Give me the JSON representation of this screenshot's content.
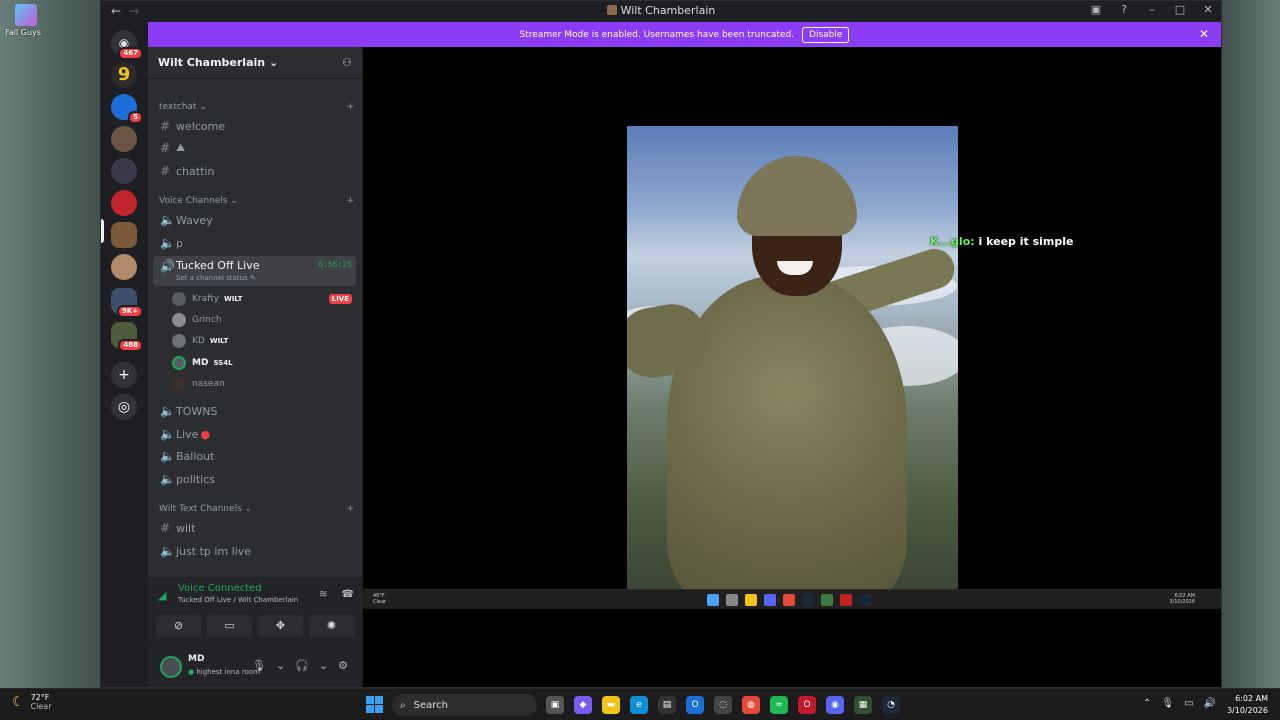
{
  "desktop": {
    "icon_label": "Fall Guys"
  },
  "window": {
    "title": "Wilt Chamberlain"
  },
  "servers": [
    {
      "badge": "467"
    },
    {
      "badge": ""
    },
    {
      "badge": "5"
    },
    {
      "badge": ""
    },
    {
      "badge": ""
    },
    {
      "badge": ""
    },
    {
      "badge": ""
    },
    {
      "badge": ""
    },
    {
      "badge": "9K+"
    },
    {
      "badge": "488"
    }
  ],
  "banner": {
    "text": "Streamer Mode is enabled. Usernames have been truncated.",
    "button": "Disable"
  },
  "guild": {
    "name": "Wilt Chamberlain"
  },
  "categories": {
    "textchat": "textchat",
    "voice": "Voice Channels",
    "wilt_text": "Wilt Text Channels"
  },
  "channels": {
    "welcome": "welcome",
    "emoji": "⛰",
    "chattin": "chattin",
    "wavey": "Wavey",
    "p": "p",
    "tucked": "Tucked Off Live",
    "tucked_timer": "6:56:25",
    "tucked_status": "Set a channel status",
    "towns": "TOWNS",
    "live": "Live",
    "ballout": "Ballout",
    "politics": "politics",
    "wilt": "wilt",
    "justtp": "just tp im live"
  },
  "voice_users": [
    {
      "name": "Krafty",
      "tag": "WILT",
      "live": "LIVE"
    },
    {
      "name": "Grinch",
      "tag": "",
      "live": ""
    },
    {
      "name": "KD",
      "tag": "WILT",
      "live": ""
    },
    {
      "name": "MD",
      "tag": "SS4L",
      "live": ""
    },
    {
      "name": "nasean",
      "tag": "",
      "live": ""
    }
  ],
  "voice_panel": {
    "title": "Voice Connected",
    "subtitle": "Tucked Off Live / Wilt Chamberlain"
  },
  "user_panel": {
    "name": "MD",
    "status": "highest inna room"
  },
  "stream": {
    "chat_name": "K...glo",
    "chat_sep": ":",
    "chat_text": "i keep it simple",
    "weather_temp": "46°F",
    "weather_cond": "Clear",
    "clock_time": "6:02 AM",
    "clock_date": "3/10/2026"
  },
  "taskbar": {
    "weather_temp": "72°F",
    "weather_cond": "Clear",
    "search_placeholder": "Search",
    "time": "6:02 AM",
    "date": "3/10/2026"
  },
  "colors": {
    "accent": "#8c3cf4",
    "online": "#23a55a",
    "danger": "#f23f43",
    "chat_name": "#64f35a"
  }
}
